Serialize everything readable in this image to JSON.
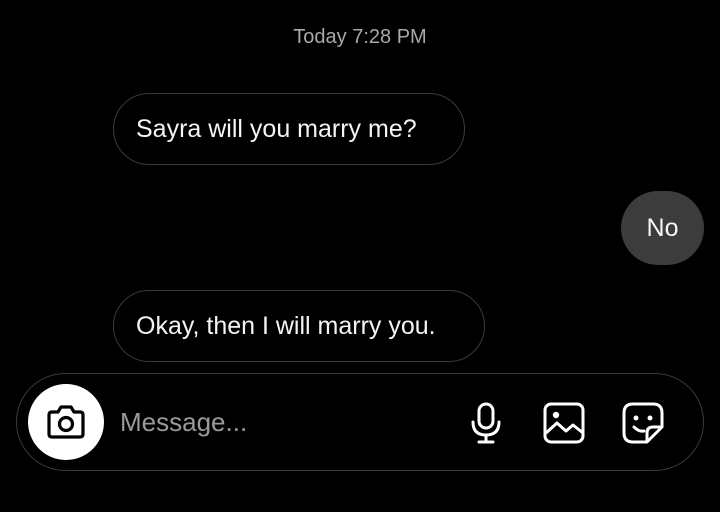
{
  "conversation": {
    "timestamp": "Today 7:28 PM",
    "messages": [
      {
        "sender": "them",
        "text": "Sayra will you marry me?"
      },
      {
        "sender": "me",
        "text": "No"
      },
      {
        "sender": "them",
        "text": "Okay, then I will marry you."
      }
    ]
  },
  "composer": {
    "placeholder": "Message...",
    "value": "",
    "camera_icon": "camera-icon",
    "mic_icon": "microphone-icon",
    "gallery_icon": "image-gallery-icon",
    "sticker_icon": "sticker-icon"
  },
  "colors": {
    "background": "#000000",
    "outgoing_bubble": "#3c3c3c",
    "incoming_border": "#3a3a3a",
    "timestamp": "#a8a8a8",
    "placeholder": "#9a9a9a"
  }
}
